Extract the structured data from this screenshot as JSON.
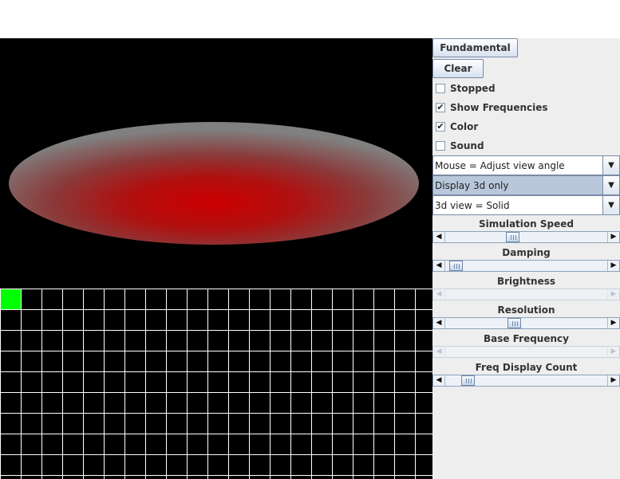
{
  "buttons": {
    "fundamental": "Fundamental",
    "clear": "Clear"
  },
  "checkboxes": [
    {
      "label": "Stopped",
      "checked": false
    },
    {
      "label": "Show Frequencies",
      "checked": true
    },
    {
      "label": "Color",
      "checked": true
    },
    {
      "label": "Sound",
      "checked": false
    }
  ],
  "combos": [
    {
      "value": "Mouse = Adjust view angle",
      "highlighted": false
    },
    {
      "value": "Display 3d only",
      "highlighted": true
    },
    {
      "value": "3d view = Solid",
      "highlighted": false
    }
  ],
  "sliders": [
    {
      "label": "Simulation Speed",
      "value": 0.41,
      "enabled": true
    },
    {
      "label": "Damping",
      "value": 0.03,
      "enabled": true
    },
    {
      "label": "Brightness",
      "value": null,
      "enabled": false
    },
    {
      "label": "Resolution",
      "value": 0.42,
      "enabled": true
    },
    {
      "label": "Base Frequency",
      "value": null,
      "enabled": false
    },
    {
      "label": "Freq Display Count",
      "value": 0.11,
      "enabled": true
    }
  ],
  "frequency_grid": {
    "columns": 20,
    "rows": 9,
    "active_cell": [
      0,
      0
    ]
  },
  "colors": {
    "membrane_center": "#cc0000",
    "membrane_edge": "#808080",
    "active_cell": "#00ff00",
    "grid_line": "#ffffff",
    "panel_background": "#eeeeee"
  }
}
